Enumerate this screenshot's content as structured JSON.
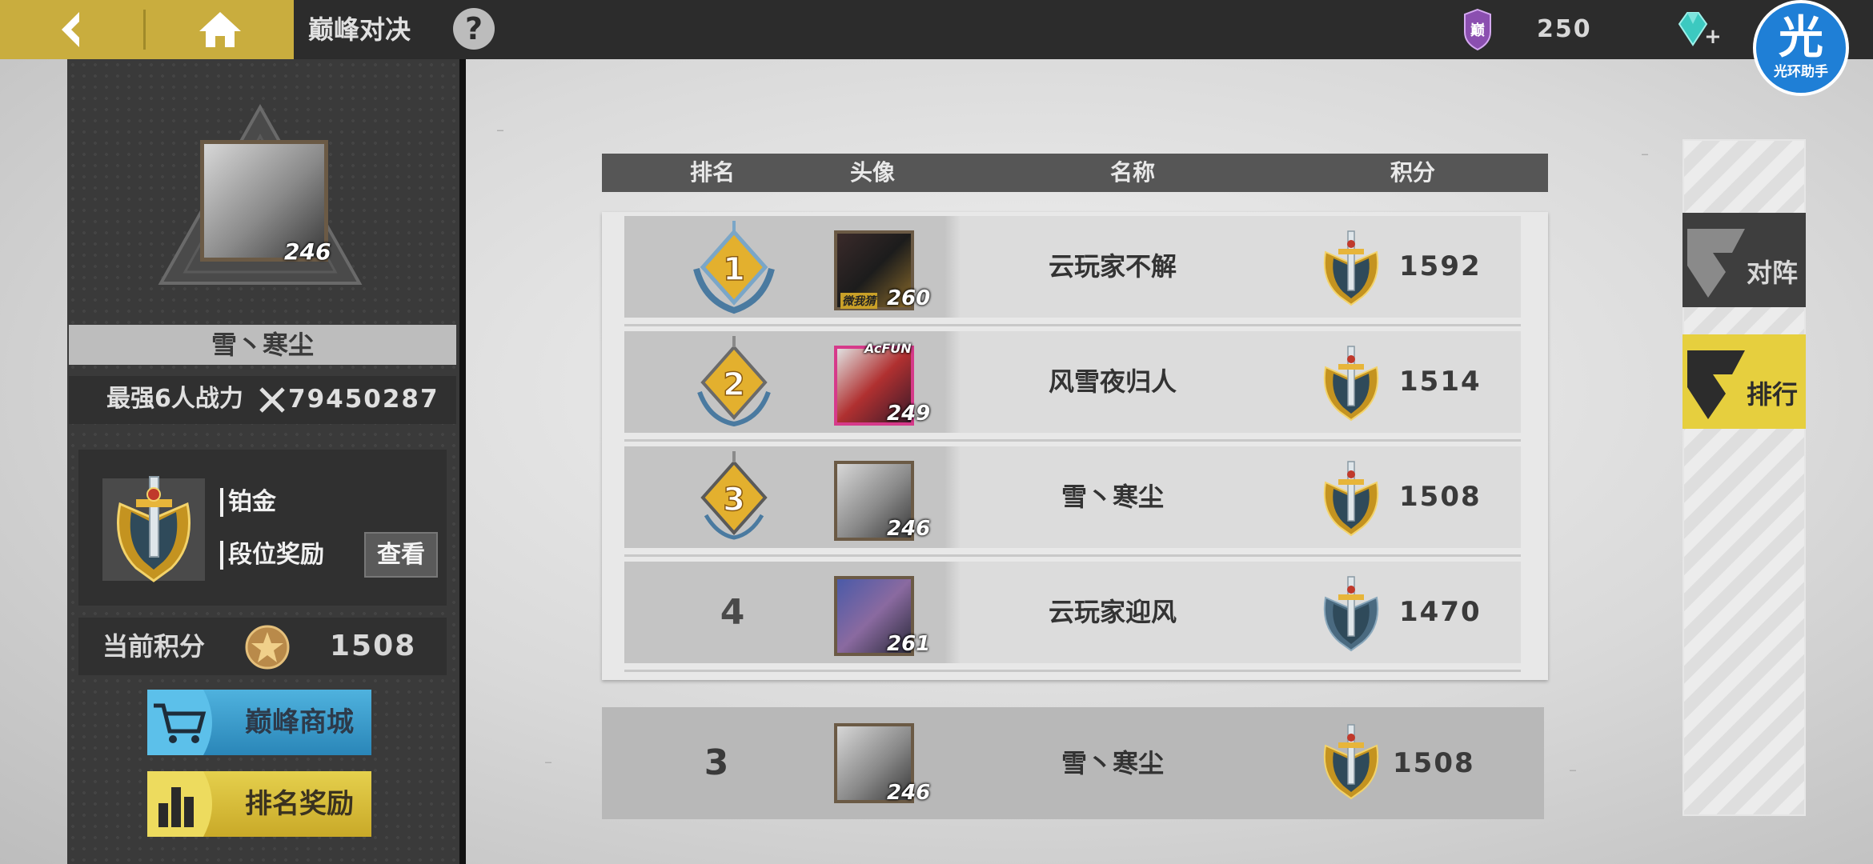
{
  "header": {
    "title": "巅峰对决",
    "help_label": "?",
    "currency_value": "250",
    "currency_badge": "巅",
    "helper": {
      "big": "光",
      "small": "光环助手"
    }
  },
  "profile": {
    "level": "246",
    "name": "雪丶寒尘",
    "power_label": "最强6人战力",
    "power_value": "79450287",
    "tier": "铂金",
    "tier_reward_label": "段位奖励",
    "view_button": "查看",
    "score_label": "当前积分",
    "score_value": "1508",
    "shop_button": "巅峰商城",
    "rank_reward_button": "排名奖励"
  },
  "table": {
    "headers": [
      "排名",
      "头像",
      "名称",
      "积分"
    ],
    "rows": [
      {
        "rank": "1",
        "level": "260",
        "name": "云玩家不解",
        "score": "1592",
        "avatar_badge": "微我猜"
      },
      {
        "rank": "2",
        "level": "249",
        "name": "风雪夜归人",
        "score": "1514",
        "avatar_badge": "AcFUN"
      },
      {
        "rank": "3",
        "level": "246",
        "name": "雪丶寒尘",
        "score": "1508"
      },
      {
        "rank": "4",
        "level": "261",
        "name": "云玩家迎风",
        "score": "1470"
      }
    ],
    "my_row": {
      "rank": "3",
      "level": "246",
      "name": "雪丶寒尘",
      "score": "1508"
    }
  },
  "tabs": {
    "match": "对阵",
    "rank": "排行"
  },
  "colors": {
    "gold": "#c9ad3e",
    "dark": "#2c2c2c",
    "panel": "#3a3a3a",
    "tab_active": "#e6cf3e",
    "shop_blue": "#2a86b8"
  },
  "icons": [
    "back-arrow-icon",
    "home-icon",
    "help-icon",
    "badge-icon",
    "gem-icon",
    "sword-emblem-icon",
    "medal-icon",
    "cart-icon",
    "bar-chart-icon"
  ]
}
